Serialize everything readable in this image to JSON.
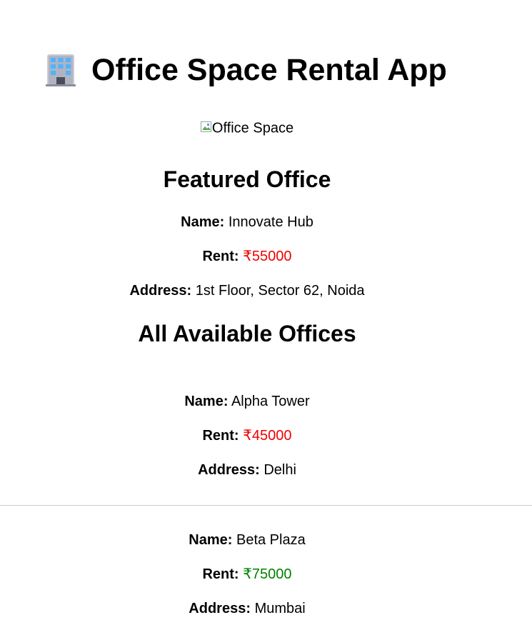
{
  "header": {
    "icon": "office-building-icon",
    "title": "Office Space Rental App"
  },
  "image": {
    "alt": "Office Space"
  },
  "featured": {
    "heading": "Featured Office",
    "name_label": "Name:",
    "name": "Innovate Hub",
    "rent_label": "Rent:",
    "rent": "₹55000",
    "rent_color": "#ee0000",
    "address_label": "Address:",
    "address": "1st Floor, Sector 62, Noida"
  },
  "all_offices": {
    "heading": "All Available Offices",
    "items": [
      {
        "name_label": "Name:",
        "name": "Alpha Tower",
        "rent_label": "Rent:",
        "rent": "₹45000",
        "rent_color": "#ee0000",
        "address_label": "Address:",
        "address": "Delhi"
      },
      {
        "name_label": "Name:",
        "name": "Beta Plaza",
        "rent_label": "Rent:",
        "rent": "₹75000",
        "rent_color": "#008000",
        "address_label": "Address:",
        "address": "Mumbai"
      }
    ]
  }
}
